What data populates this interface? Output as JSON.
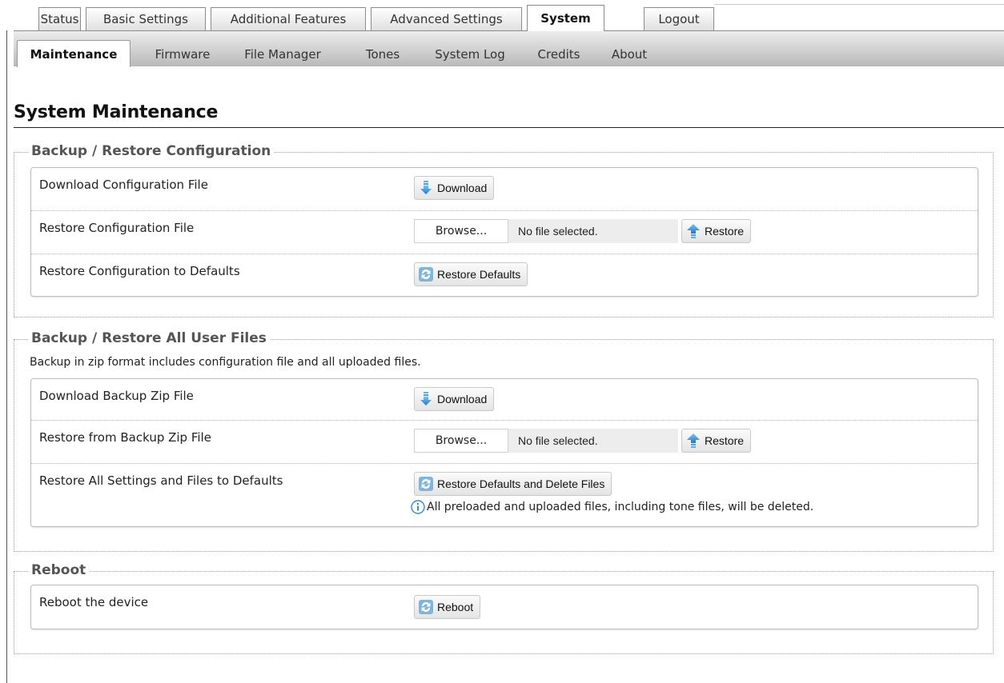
{
  "main_tabs": [
    {
      "label": "Status",
      "active": false
    },
    {
      "label": "Basic Settings",
      "active": false
    },
    {
      "label": "Additional Features",
      "active": false
    },
    {
      "label": "Advanced Settings",
      "active": false
    },
    {
      "label": "System",
      "active": true
    },
    {
      "label": "Logout",
      "active": false
    }
  ],
  "sub_tabs": [
    {
      "label": "Maintenance",
      "active": true
    },
    {
      "label": "Firmware",
      "active": false
    },
    {
      "label": "File Manager",
      "active": false
    },
    {
      "label": "Tones",
      "active": false
    },
    {
      "label": "System Log",
      "active": false
    },
    {
      "label": "Credits",
      "active": false
    },
    {
      "label": "About",
      "active": false
    }
  ],
  "page_title": "System Maintenance",
  "config_section": {
    "legend": "Backup / Restore Configuration",
    "download_label": "Download Configuration File",
    "download_button": "Download",
    "restore_label": "Restore Configuration File",
    "browse_button": "Browse...",
    "file_status": "No file selected.",
    "restore_button": "Restore",
    "defaults_label": "Restore Configuration to Defaults",
    "defaults_button": "Restore Defaults"
  },
  "files_section": {
    "legend": "Backup / Restore All User Files",
    "description": "Backup in zip format includes configuration file and all uploaded files.",
    "download_label": "Download Backup Zip File",
    "download_button": "Download",
    "restore_label": "Restore from Backup Zip File",
    "browse_button": "Browse...",
    "file_status": "No file selected.",
    "restore_button": "Restore",
    "defaults_label": "Restore All Settings and Files to Defaults",
    "defaults_button": "Restore Defaults and Delete Files",
    "warning": "All preloaded and uploaded files, including tone files, will be deleted."
  },
  "reboot_section": {
    "legend": "Reboot",
    "label": "Reboot the device",
    "button": "Reboot"
  },
  "icons": {
    "download": "download-arrow-icon",
    "upload": "upload-arrow-icon",
    "refresh": "refresh-icon",
    "info": "info-icon"
  },
  "colors": {
    "icon_blue": "#2f8fd6",
    "legend_gray": "#555555",
    "tab_border": "#8c8c8c"
  }
}
